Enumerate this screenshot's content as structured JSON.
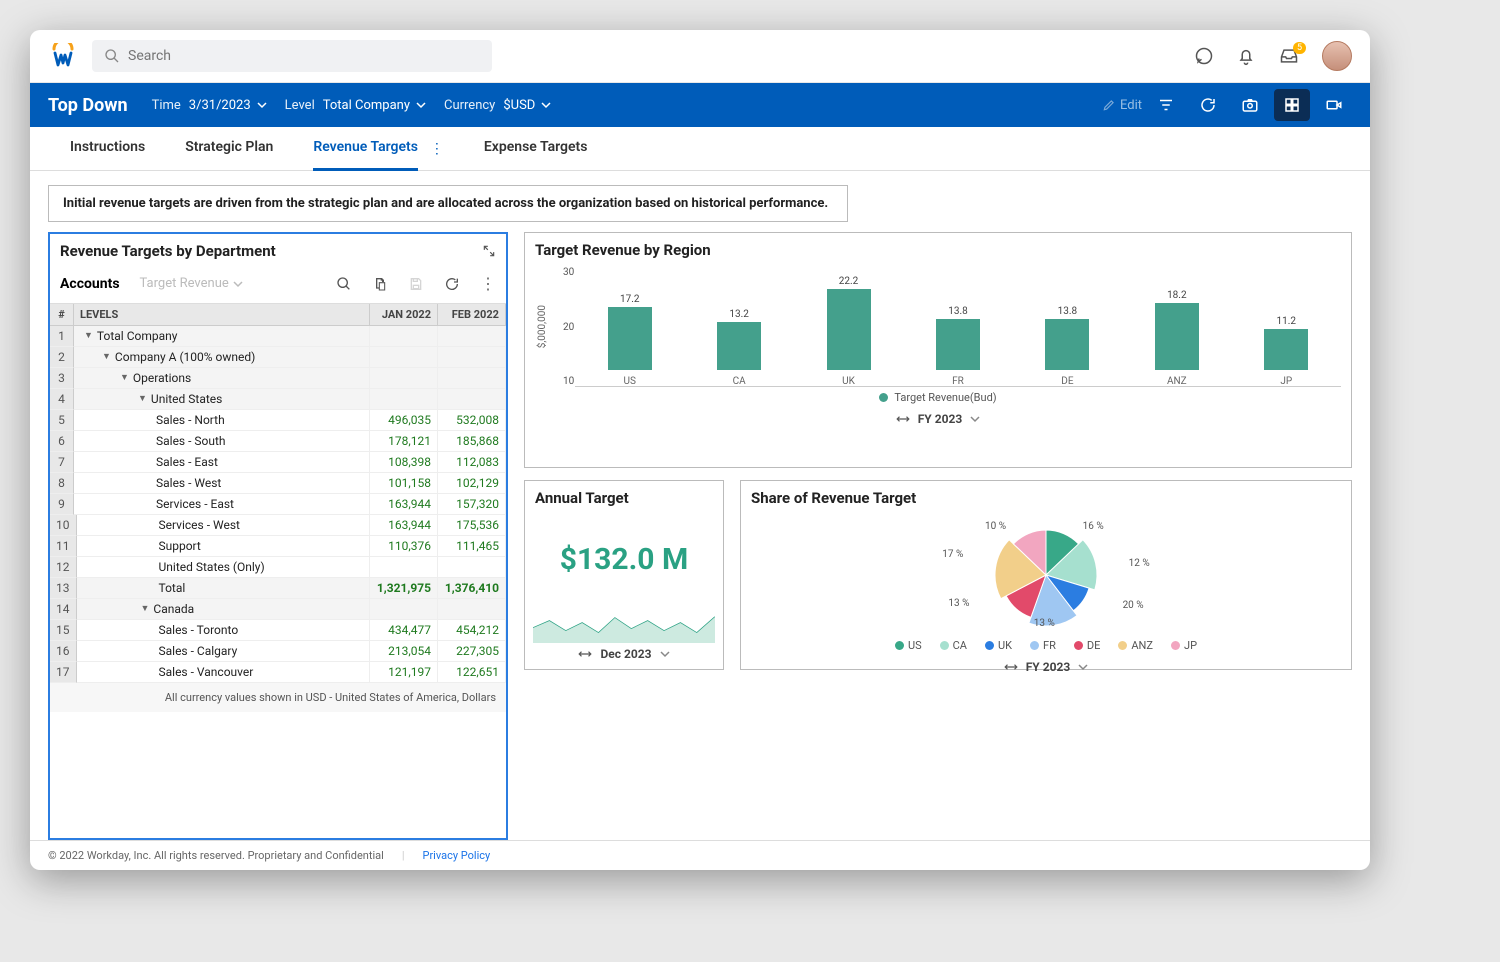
{
  "search": {
    "placeholder": "Search"
  },
  "topIcons": {
    "inboxBadge": "5"
  },
  "bluebar": {
    "title": "Top Down",
    "time": {
      "label": "Time",
      "value": "3/31/2023"
    },
    "level": {
      "label": "Level",
      "value": "Total Company"
    },
    "currency": {
      "label": "Currency",
      "value": "$USD"
    },
    "edit": "Edit"
  },
  "tabs": [
    "Instructions",
    "Strategic Plan",
    "Revenue Targets",
    "Expense Targets"
  ],
  "activeTab": 2,
  "banner": "Initial revenue targets are driven from the strategic plan and are allocated across the organization based on historical performance.",
  "deptCard": {
    "title": "Revenue Targets by Department",
    "accountsLabel": "Accounts",
    "targetRevLabel": "Target Revenue",
    "columns": {
      "num": "#",
      "levels": "LEVELS",
      "c1": "JAN 2022",
      "c2": "FEB 2022"
    },
    "rows": [
      {
        "n": 1,
        "indent": 0,
        "caret": true,
        "label": "Total Company",
        "shade": true
      },
      {
        "n": 2,
        "indent": 1,
        "caret": true,
        "label": "Company A (100% owned)",
        "shade": true
      },
      {
        "n": 3,
        "indent": 2,
        "caret": true,
        "label": "Operations",
        "shade": true
      },
      {
        "n": 4,
        "indent": 3,
        "caret": true,
        "label": "United States",
        "shade": true
      },
      {
        "n": 5,
        "indent": 4,
        "label": "Sales - North",
        "v1": "496,035",
        "v2": "532,008"
      },
      {
        "n": 6,
        "indent": 4,
        "label": "Sales - South",
        "v1": "178,121",
        "v2": "185,868"
      },
      {
        "n": 7,
        "indent": 4,
        "label": "Sales - East",
        "v1": "108,398",
        "v2": "112,083"
      },
      {
        "n": 8,
        "indent": 4,
        "label": "Sales - West",
        "v1": "101,158",
        "v2": "102,129"
      },
      {
        "n": 9,
        "indent": 4,
        "label": "Services - East",
        "v1": "163,944",
        "v2": "157,320"
      },
      {
        "n": 10,
        "indent": 4,
        "label": "Services - West",
        "v1": "163,944",
        "v2": "175,536"
      },
      {
        "n": 11,
        "indent": 4,
        "label": "Support",
        "v1": "110,376",
        "v2": "111,465"
      },
      {
        "n": 12,
        "indent": 4,
        "label": "United States (Only)"
      },
      {
        "n": 13,
        "indent": 4,
        "label": "Total",
        "v1": "1,321,975",
        "v2": "1,376,410",
        "bold": true,
        "shade": true
      },
      {
        "n": 14,
        "indent": 3,
        "caret": true,
        "label": "Canada",
        "shade": true
      },
      {
        "n": 15,
        "indent": 4,
        "label": "Sales - Toronto",
        "v1": "434,477",
        "v2": "454,212"
      },
      {
        "n": 16,
        "indent": 4,
        "label": "Sales - Calgary",
        "v1": "213,054",
        "v2": "227,305"
      },
      {
        "n": 17,
        "indent": 4,
        "label": "Sales - Vancouver",
        "v1": "121,197",
        "v2": "122,651"
      }
    ],
    "footnote": "All currency values shown in USD - United States of America, Dollars"
  },
  "regionCard": {
    "title": "Target Revenue by Region",
    "legend": "Target Revenue(Bud)",
    "period": "FY 2023",
    "ylabel": "$,000,000",
    "yticks": [
      "30",
      "20",
      "10"
    ]
  },
  "annualCard": {
    "title": "Annual Target",
    "value": "$132.0 M",
    "period": "Dec 2023"
  },
  "shareCard": {
    "title": "Share of Revenue Target",
    "period": "FY 2023",
    "legendItems": [
      "US",
      "CA",
      "UK",
      "FR",
      "DE",
      "ANZ",
      "JP"
    ],
    "colors": [
      "#38a888",
      "#a6e0cf",
      "#2b7de1",
      "#9fc7f2",
      "#e24a6a",
      "#f2cf8a",
      "#f2a6c0"
    ],
    "labels": [
      "10 %",
      "16 %",
      "12 %",
      "20 %",
      "13 %",
      "13 %",
      "17 %"
    ]
  },
  "footer": {
    "copyright": "© 2022 Workday, Inc. All rights reserved. Proprietary and Confidential",
    "privacy": "Privacy Policy"
  },
  "chart_data": [
    {
      "type": "bar",
      "title": "Target Revenue by Region",
      "ylabel": "$,000,000",
      "ylim": [
        0,
        30
      ],
      "categories": [
        "US",
        "CA",
        "UK",
        "FR",
        "DE",
        "ANZ",
        "JP"
      ],
      "series": [
        {
          "name": "Target Revenue(Bud)",
          "values": [
            17.2,
            13.2,
            22.2,
            13.8,
            13.8,
            18.2,
            11.2
          ]
        }
      ]
    },
    {
      "type": "pie",
      "title": "Share of Revenue Target",
      "categories": [
        "US",
        "CA",
        "UK",
        "FR",
        "DE",
        "ANZ",
        "JP"
      ],
      "values": [
        13,
        17,
        10,
        16,
        12,
        20,
        13
      ]
    },
    {
      "type": "line",
      "title": "Annual Target sparkline",
      "x": [
        1,
        2,
        3,
        4,
        5,
        6,
        7,
        8,
        9,
        10,
        11,
        12
      ],
      "values": [
        10,
        11,
        10.5,
        12,
        11,
        13,
        11.5,
        12.5,
        11,
        12,
        11.5,
        13
      ]
    }
  ]
}
